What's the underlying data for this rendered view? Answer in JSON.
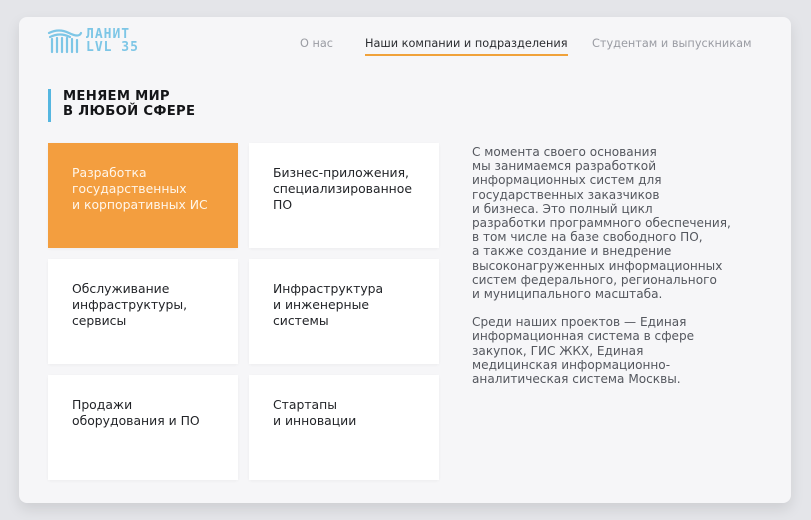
{
  "logo": {
    "line1": "ЛАНИТ",
    "line2": "LVL 35",
    "color": "#7dc6e6"
  },
  "nav": {
    "items": [
      {
        "label": "О нас",
        "active": false
      },
      {
        "label": "Наши компании и подразделения",
        "active": true
      },
      {
        "label": "Студентам и выпускникам",
        "active": false
      }
    ],
    "active_underline_color": "#f0a23b"
  },
  "headline": {
    "line1": "МЕНЯЕМ МИР",
    "line2": "В ЛЮБОЙ СФЕРЕ",
    "accent_color": "#55b6e0"
  },
  "cards": [
    {
      "lines": [
        "Разработка",
        "государственных",
        "и корпоративных ИС"
      ],
      "active": true
    },
    {
      "lines": [
        "Бизнес-приложения,",
        "специализированное",
        "ПО"
      ],
      "active": false
    },
    {
      "lines": [
        "Обслуживание",
        "инфраструктуры,",
        "сервисы"
      ],
      "active": false
    },
    {
      "lines": [
        "Инфраструктура",
        "и инженерные",
        "системы"
      ],
      "active": false
    },
    {
      "lines": [
        "Продажи",
        "оборудования и ПО"
      ],
      "active": false
    },
    {
      "lines": [
        "Стартапы",
        "и инновации"
      ],
      "active": false
    }
  ],
  "card_active_color": "#f39e3f",
  "description": {
    "paragraph1": [
      "С момента своего основания",
      "мы занимаемся разработкой",
      "информационных систем для",
      "государственных заказчиков",
      "и бизнеса. Это полный цикл",
      "разработки программного обеспечения,",
      "в том числе на базе свободного ПО,",
      "а также создание и внедрение",
      "высоконагруженных информационных",
      "систем федерального, регионального",
      "и муниципального масштаба."
    ],
    "paragraph2": [
      "Среди наших проектов — Единая",
      "информационная система в сфере",
      "закупок, ГИС ЖКХ, Единая",
      "медицинская информационно-",
      "аналитическая система Москвы."
    ]
  }
}
